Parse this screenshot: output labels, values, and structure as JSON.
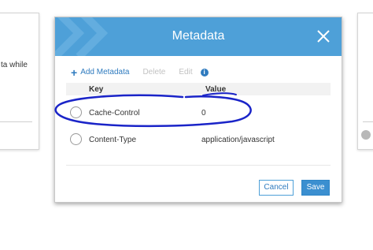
{
  "background": {
    "left_card_fragment": "ta while"
  },
  "modal": {
    "title": "Metadata",
    "toolbar": {
      "add_label": "Add Metadata",
      "delete_label": "Delete",
      "edit_label": "Edit"
    },
    "table": {
      "headers": {
        "key": "Key",
        "value": "Value"
      },
      "rows": [
        {
          "key": "Cache-Control",
          "value": "0"
        },
        {
          "key": "Content-Type",
          "value": "application/javascript"
        }
      ]
    },
    "footer": {
      "cancel_label": "Cancel",
      "save_label": "Save"
    }
  },
  "colors": {
    "header_blue": "#4ea0d8",
    "link_blue": "#2f7bbf",
    "annotation_blue": "#1a24c8"
  },
  "icons": [
    "chevron-pattern-icon",
    "close-icon",
    "plus-icon",
    "info-icon"
  ]
}
